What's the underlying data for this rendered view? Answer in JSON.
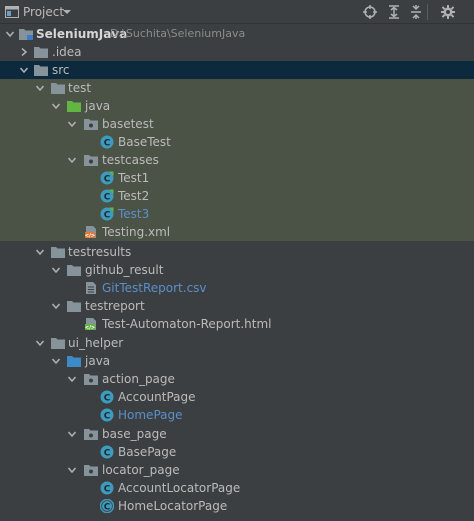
{
  "header": {
    "title": "Project",
    "icons": [
      "project-window-icon",
      "dropdown-arrow-icon",
      "locate-icon",
      "expand-all-icon",
      "collapse-all-icon",
      "settings-gear-icon"
    ]
  },
  "tree": {
    "project_name": "SeleniumJava",
    "project_path": "D:\\Suchita\\SeleniumJava",
    "idea": ".idea",
    "src": "src",
    "test": "test",
    "test_java": "java",
    "basetest": "basetest",
    "basetest_class": "BaseTest",
    "testcases": "testcases",
    "test1": "Test1",
    "test2": "Test2",
    "test3": "Test3",
    "testing_xml": "Testing.xml",
    "testresults": "testresults",
    "github_result": "github_result",
    "github_csv": "GitTestReport.csv",
    "testreport": "testreport",
    "report_html": "Test-Automaton-Report.html",
    "ui_helper": "ui_helper",
    "ui_java": "java",
    "action_page": "action_page",
    "account_page": "AccountPage",
    "home_page": "HomePage",
    "base_page": "base_page",
    "base_page_class": "BasePage",
    "locator_page": "locator_page",
    "account_locator_page": "AccountLocatorPage",
    "home_locator_page": "HomeLocatorPage"
  },
  "colors": {
    "panel_bg": "#3c3f41",
    "selection_dark": "#0d293e",
    "selection_green": "#4b5246",
    "text": "#bbbbbb",
    "modified_blue": "#5b8fc9",
    "class_icon": "#3d9bbd"
  }
}
